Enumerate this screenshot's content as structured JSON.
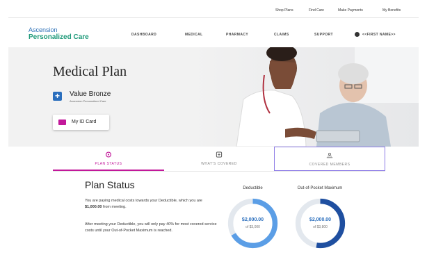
{
  "utility_nav": [
    "Shop Plans",
    "Find Care",
    "Make Payments",
    "My Benefits"
  ],
  "brand": {
    "line1": "Ascension",
    "line2": "Personalized Care"
  },
  "main_nav": [
    "DASHBOARD",
    "MEDICAL",
    "PHARMACY",
    "CLAIMS",
    "SUPPORT"
  ],
  "user": {
    "name": "<<FIRST NAME>>",
    "icon": "user-circle-icon"
  },
  "hero": {
    "title": "Medical Plan",
    "plan_name": "Value Bronze",
    "plan_sub": "Ascension Personalized Care",
    "id_card_label": "My ID Card"
  },
  "tabs": [
    {
      "label": "PLAN STATUS",
      "icon": "plan-status-icon",
      "active": true
    },
    {
      "label": "WHAT'S COVERED",
      "icon": "covered-icon",
      "active": false
    },
    {
      "label": "COVERED MEMBERS",
      "icon": "members-icon",
      "active": false
    }
  ],
  "plan_status": {
    "title": "Plan Status",
    "para1_a": "You are paying medical costs towards your Deductible, which you are ",
    "para1_amount": "$1,000.00",
    "para1_b": " from meeting.",
    "para2": "After meeting your Deductible, you will only pay 40% for most covered service costs until your Out-of-Pocket Maximum is reached."
  },
  "meters": [
    {
      "title": "Deductible",
      "amount": "$2,000.00",
      "of": "of $3,000",
      "fraction": 0.667,
      "color": "#5b9ee6"
    },
    {
      "title": "Out-of-Pocket Maximum",
      "amount": "$2,000.00",
      "of": "of $3,800",
      "fraction": 0.526,
      "color": "#1f4fa0"
    }
  ],
  "colors": {
    "accent": "#c2189a",
    "brand_blue": "#2a6ebd",
    "brand_green": "#1f9a7a",
    "focus": "#8c7ae6"
  }
}
